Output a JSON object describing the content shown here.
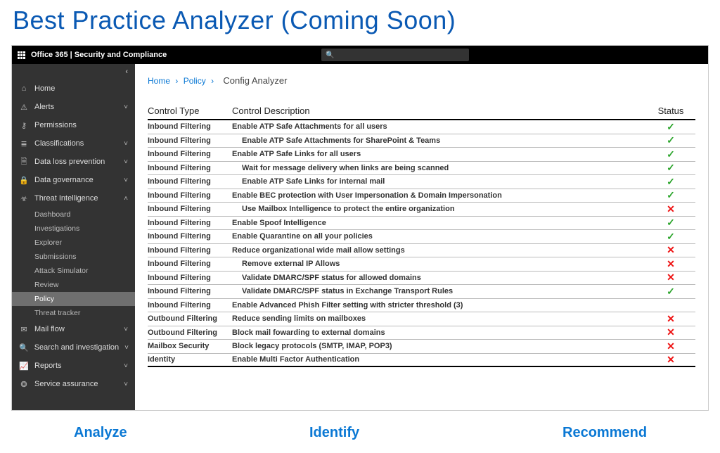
{
  "page_heading": "Best Practice Analyzer (Coming Soon)",
  "header": {
    "title": "Office 365 | Security and Compliance",
    "search_placeholder": ""
  },
  "sidebar": {
    "items": [
      {
        "icon": "home-icon",
        "glyph": "⌂",
        "label": "Home",
        "expand": ""
      },
      {
        "icon": "alerts-icon",
        "glyph": "⚠",
        "label": "Alerts",
        "expand": "˅"
      },
      {
        "icon": "permissions-icon",
        "glyph": "⚷",
        "label": "Permissions",
        "expand": ""
      },
      {
        "icon": "classifications-icon",
        "glyph": "≣",
        "label": "Classifications",
        "expand": "˅"
      },
      {
        "icon": "dlp-icon",
        "glyph": "🗎",
        "label": "Data loss prevention",
        "expand": "˅"
      },
      {
        "icon": "governance-icon",
        "glyph": "🔒",
        "label": "Data governance",
        "expand": "˅"
      },
      {
        "icon": "threat-icon",
        "glyph": "☣",
        "label": "Threat Intelligence",
        "expand": "˄",
        "children": [
          {
            "label": "Dashboard",
            "active": false
          },
          {
            "label": "Investigations",
            "active": false
          },
          {
            "label": "Explorer",
            "active": false
          },
          {
            "label": "Submissions",
            "active": false
          },
          {
            "label": "Attack Simulator",
            "active": false
          },
          {
            "label": "Review",
            "active": false
          },
          {
            "label": "Policy",
            "active": true
          },
          {
            "label": "Threat tracker",
            "active": false
          }
        ]
      },
      {
        "icon": "mailflow-icon",
        "glyph": "✉",
        "label": "Mail flow",
        "expand": "˅"
      },
      {
        "icon": "search-icon",
        "glyph": "🔍",
        "label": "Search and investigation",
        "expand": "˅"
      },
      {
        "icon": "reports-icon",
        "glyph": "📈",
        "label": "Reports",
        "expand": "˅"
      },
      {
        "icon": "service-icon",
        "glyph": "❂",
        "label": "Service assurance",
        "expand": "˅"
      }
    ]
  },
  "breadcrumb": {
    "home": "Home",
    "policy": "Policy",
    "current": "Config Analyzer"
  },
  "table": {
    "headers": {
      "type": "Control Type",
      "desc": "Control Description",
      "status": "Status"
    },
    "rows": [
      {
        "type": "Inbound Filtering",
        "desc": "Enable ATP Safe Attachments for all users",
        "indent": false,
        "status": "ok"
      },
      {
        "type": "Inbound Filtering",
        "desc": "Enable ATP Safe Attachments for SharePoint & Teams",
        "indent": true,
        "status": "ok"
      },
      {
        "type": "Inbound Filtering",
        "desc": "Enable ATP Safe Links for all users",
        "indent": false,
        "status": "ok"
      },
      {
        "type": "Inbound Filtering",
        "desc": "Wait for message delivery when links are being scanned",
        "indent": true,
        "status": "ok"
      },
      {
        "type": "Inbound Filtering",
        "desc": "Enable ATP Safe Links for internal mail",
        "indent": true,
        "status": "ok"
      },
      {
        "type": "Inbound Filtering",
        "desc": "Enable BEC protection with User Impersonation & Domain Impersonation",
        "indent": false,
        "status": "ok"
      },
      {
        "type": "Inbound Filtering",
        "desc": "Use Mailbox Intelligence to protect the entire organization",
        "indent": true,
        "status": "bad"
      },
      {
        "type": "Inbound Filtering",
        "desc": "Enable  Spoof Intelligence",
        "indent": false,
        "status": "ok"
      },
      {
        "type": "Inbound Filtering",
        "desc": "Enable Quarantine on all your policies",
        "indent": false,
        "status": "ok"
      },
      {
        "type": "Inbound Filtering",
        "desc": "Reduce organizational wide mail allow settings",
        "indent": false,
        "status": "bad"
      },
      {
        "type": "Inbound Filtering",
        "desc": "Remove external IP Allows",
        "indent": true,
        "status": "bad"
      },
      {
        "type": "Inbound Filtering",
        "desc": "Validate DMARC/SPF status for allowed domains",
        "indent": true,
        "status": "bad"
      },
      {
        "type": "Inbound Filtering",
        "desc": "Validate DMARC/SPF status in Exchange Transport Rules",
        "indent": true,
        "status": "ok"
      },
      {
        "type": "Inbound Filtering",
        "desc": "Enable Advanced Phish Filter setting with stricter threshold (3)",
        "indent": false,
        "status": ""
      },
      {
        "type": "Outbound Filtering",
        "desc": "Reduce sending limits on mailboxes",
        "indent": false,
        "status": "bad"
      },
      {
        "type": "Outbound Filtering",
        "desc": "Block mail fowarding to external domains",
        "indent": false,
        "status": "bad"
      },
      {
        "type": "Mailbox Security",
        "desc": "Block legacy protocols (SMTP, IMAP, POP3)",
        "indent": false,
        "status": "bad"
      },
      {
        "type": "Identity",
        "desc": "Enable Multi Factor Authentication",
        "indent": false,
        "status": "bad"
      }
    ]
  },
  "footer": {
    "analyze": "Analyze",
    "identify": "Identify",
    "recommend": "Recommend"
  }
}
